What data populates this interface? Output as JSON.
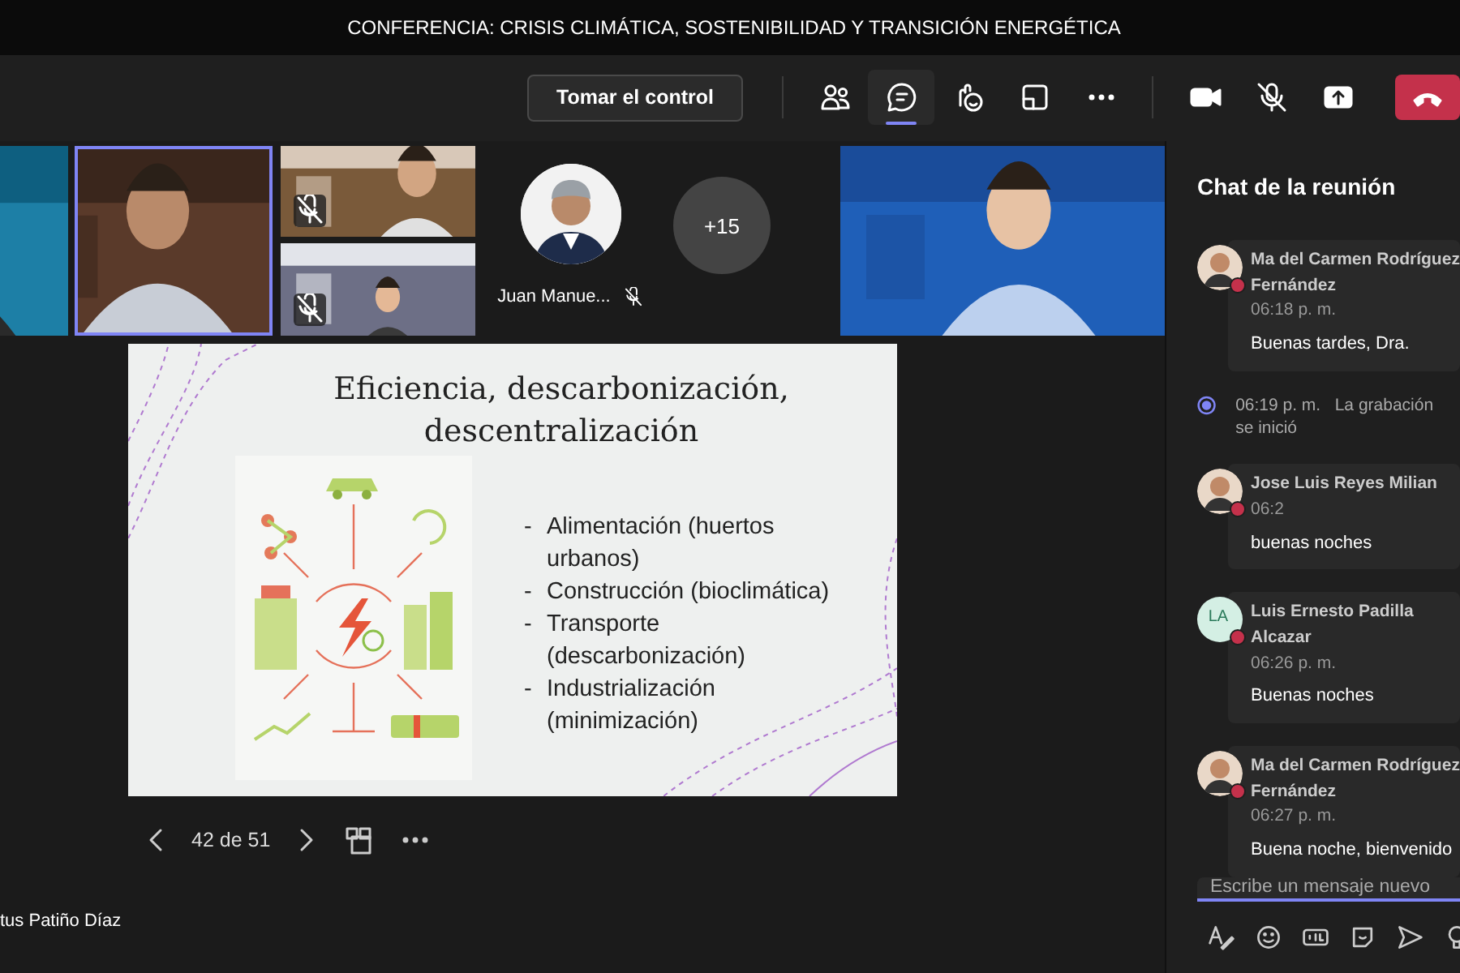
{
  "window": {
    "title": "CONFERENCIA: CRISIS CLIMÁTICA, SOSTENIBILIDAD Y TRANSICIÓN ENERGÉTICA"
  },
  "toolbar": {
    "take_control": "Tomar el control",
    "tools": [
      {
        "kind": "people",
        "selected": false
      },
      {
        "kind": "chat",
        "selected": true
      },
      {
        "kind": "reactions",
        "selected": false
      },
      {
        "kind": "rooms",
        "selected": false
      },
      {
        "kind": "more",
        "selected": false
      },
      {
        "kind": "camera"
      },
      {
        "kind": "mic",
        "muted": true
      },
      {
        "kind": "share"
      },
      {
        "kind": "hangup"
      }
    ]
  },
  "participants": [
    {
      "kind": "picture",
      "selected": false,
      "muted": false
    },
    {
      "kind": "picture",
      "selected": true,
      "muted": false
    },
    {
      "kind": "picture",
      "selected": false,
      "muted": true
    },
    {
      "kind": "picture",
      "selected": false,
      "muted": true
    },
    {
      "kind": "avatar",
      "name": "Juan Manue...",
      "muted": true
    },
    {
      "kind": "overflow",
      "count": "+15"
    },
    {
      "kind": "picture",
      "selected": false,
      "muted": false
    }
  ],
  "slide": {
    "title": "Eficiencia, descarbonización, descentralización",
    "marker": "-",
    "bullets": [
      "Alimentación (huertos urbanos)",
      "Construcción (bioclimática)",
      "Transporte (descarbonización)",
      "Industrialización (minimización)"
    ]
  },
  "slide_nav": {
    "page": "42 de 51"
  },
  "presenter": "tus Patiño Díaz",
  "chat": {
    "title": "Chat de la reunión",
    "messages": [
      {
        "kind": "message",
        "author": "Ma del Carmen Rodríguez Fernández",
        "time": "06:18 p. m.",
        "text": "Buenas tardes, Dra."
      },
      {
        "kind": "system",
        "time": "06:19 p. m.",
        "text": "La grabación se inició"
      },
      {
        "kind": "message",
        "author": "Jose Luis Reyes Milian",
        "time": "06:2",
        "text": "buenas noches"
      },
      {
        "kind": "message",
        "author": "Luis Ernesto Padilla Alcazar",
        "initials": "LA",
        "time": "06:26 p. m.",
        "text": "Buenas noches"
      },
      {
        "kind": "message",
        "author": "Ma del Carmen Rodríguez Fernández",
        "time": "06:27 p. m.",
        "text": "Buena noche, bienvenido"
      }
    ],
    "input": {
      "placeholder": "Escribe un mensaje nuevo"
    }
  }
}
